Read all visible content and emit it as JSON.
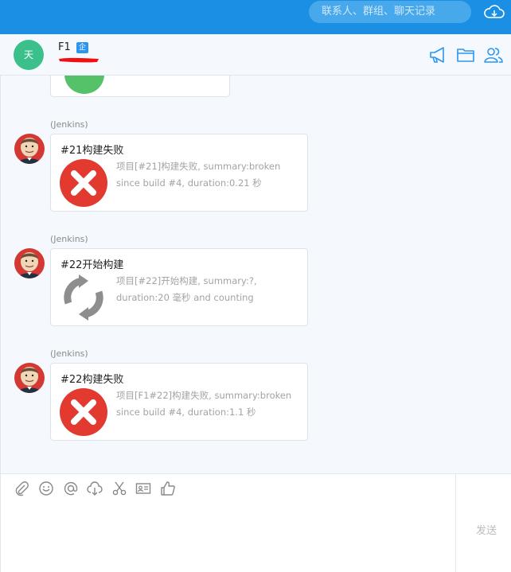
{
  "topbar": {
    "search_placeholder": "联系人、群组、聊天记录",
    "accent": "#1a8fe3"
  },
  "chat": {
    "avatar_text": "天",
    "name": "F1",
    "badge": "企"
  },
  "messages": [
    {
      "sender": "(Jenkins)",
      "title": "#21构建失败",
      "icon": "failure-x-icon",
      "desc_line1": "项目[#21]构建失败, summary:broken",
      "desc_line2": "since build #4, duration:0.21 秒"
    },
    {
      "sender": "(Jenkins)",
      "title": "#22开始构建",
      "icon": "refresh-icon",
      "desc_line1": "项目[#22]开始构建, summary:?,",
      "desc_line2": "duration:20 毫秒 and counting"
    },
    {
      "sender": "(Jenkins)",
      "title": "#22构建失败",
      "icon": "failure-x-icon",
      "desc_line1": "项目[F1#22]构建失败, summary:broken",
      "desc_line2": "since build #4, duration:1.1 秒"
    }
  ],
  "composer": {
    "tools": [
      "paperclip-icon",
      "emoji-icon",
      "at-icon",
      "cloud-download-icon",
      "scissors-icon",
      "contact-card-icon",
      "thumbs-up-icon"
    ],
    "send_label": "发送"
  },
  "colors": {
    "failure_red": "#e23a2e",
    "success_green": "#55c26a",
    "refresh_gray": "#8e8e8e",
    "icon_blue": "#2b95f0"
  }
}
